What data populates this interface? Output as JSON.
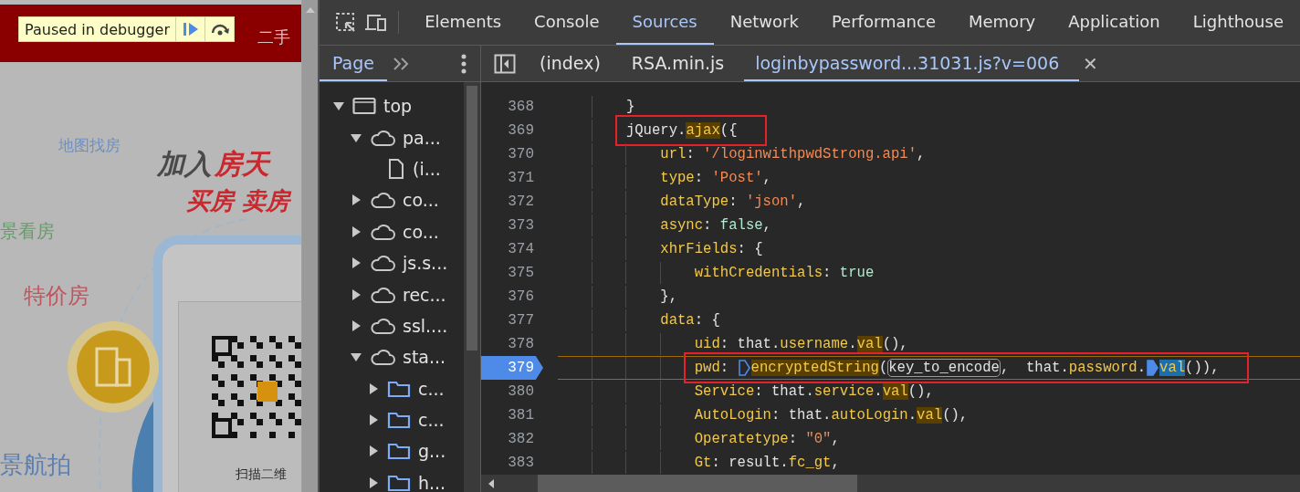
{
  "page": {
    "nav_item": "二手",
    "labels": [
      {
        "text": "地图找房",
        "color": "#6f8fc2"
      },
      {
        "text": "景看房",
        "color": "#6a9a6e"
      },
      {
        "text": "特价房",
        "color": "#c4545c"
      },
      {
        "text": "景航拍",
        "color": "#5b7fb4"
      }
    ],
    "heading": [
      {
        "text": "加入",
        "color": "#4a4a4a"
      },
      {
        "text": "房天",
        "color": "#c8282e"
      }
    ],
    "subheading": "买房 卖房",
    "qr_caption": "扫描二维"
  },
  "debugger_banner": {
    "text": "Paused in debugger"
  },
  "toolbar_tabs": [
    {
      "label": "Elements",
      "selected": false
    },
    {
      "label": "Console",
      "selected": false
    },
    {
      "label": "Sources",
      "selected": true
    },
    {
      "label": "Network",
      "selected": false
    },
    {
      "label": "Performance",
      "selected": false
    },
    {
      "label": "Memory",
      "selected": false
    },
    {
      "label": "Application",
      "selected": false
    },
    {
      "label": "Lighthouse",
      "selected": false
    }
  ],
  "navigator": {
    "tabs": [
      {
        "label": "Page",
        "selected": true
      }
    ],
    "tree": [
      {
        "label": "top",
        "kind": "frame",
        "expanded": true,
        "children": [
          {
            "label": "pa...",
            "kind": "cloud",
            "expanded": true,
            "children": [
              {
                "label": "(i...",
                "kind": "file"
              }
            ]
          },
          {
            "label": "co...",
            "kind": "cloud",
            "expanded": false
          },
          {
            "label": "co...",
            "kind": "cloud",
            "expanded": false
          },
          {
            "label": "js.s...",
            "kind": "cloud",
            "expanded": false
          },
          {
            "label": "rec...",
            "kind": "cloud",
            "expanded": false
          },
          {
            "label": "ssl....",
            "kind": "cloud",
            "expanded": false
          },
          {
            "label": "sta...",
            "kind": "cloud",
            "expanded": true,
            "children": [
              {
                "label": "c...",
                "kind": "folder",
                "expanded": false
              },
              {
                "label": "c...",
                "kind": "folder",
                "expanded": false
              },
              {
                "label": "g...",
                "kind": "folder",
                "expanded": false
              },
              {
                "label": "h...",
                "kind": "folder",
                "expanded": false
              }
            ]
          }
        ]
      }
    ]
  },
  "editor_tabs": [
    {
      "label": "(index)",
      "selected": false
    },
    {
      "label": "RSA.min.js",
      "selected": false
    },
    {
      "label": "loginbypassword...31031.js?v=006",
      "selected": true,
      "close_label": "✕"
    }
  ],
  "code_lines": [
    {
      "number": "368",
      "tokens": [
        {
          "text": "        }",
          "kind": "plain"
        }
      ]
    },
    {
      "number": "369",
      "annotated": true,
      "tokens": [
        {
          "text": "        jQuery.",
          "kind": "plain"
        },
        {
          "text": "ajax",
          "kind": "hl"
        },
        {
          "text": "({",
          "kind": "plain"
        }
      ]
    },
    {
      "number": "370",
      "tokens": [
        {
          "text": "            url",
          "kind": "prop"
        },
        {
          "text": ": ",
          "kind": "plain"
        },
        {
          "text": "'/loginwithpwdStrong.api'",
          "kind": "string"
        },
        {
          "text": ",",
          "kind": "plain"
        }
      ]
    },
    {
      "number": "371",
      "tokens": [
        {
          "text": "            type",
          "kind": "prop"
        },
        {
          "text": ": ",
          "kind": "plain"
        },
        {
          "text": "'Post'",
          "kind": "string"
        },
        {
          "text": ",",
          "kind": "plain"
        }
      ]
    },
    {
      "number": "372",
      "tokens": [
        {
          "text": "            dataType",
          "kind": "prop"
        },
        {
          "text": ": ",
          "kind": "plain"
        },
        {
          "text": "'json'",
          "kind": "string"
        },
        {
          "text": ",",
          "kind": "plain"
        }
      ]
    },
    {
      "number": "373",
      "tokens": [
        {
          "text": "            async",
          "kind": "prop"
        },
        {
          "text": ": ",
          "kind": "plain"
        },
        {
          "text": "false",
          "kind": "literal"
        },
        {
          "text": ",",
          "kind": "plain"
        }
      ]
    },
    {
      "number": "374",
      "tokens": [
        {
          "text": "            xhrFields",
          "kind": "prop"
        },
        {
          "text": ": {",
          "kind": "plain"
        }
      ]
    },
    {
      "number": "375",
      "tokens": [
        {
          "text": "                withCredentials",
          "kind": "prop"
        },
        {
          "text": ": ",
          "kind": "plain"
        },
        {
          "text": "true",
          "kind": "literal"
        }
      ]
    },
    {
      "number": "376",
      "tokens": [
        {
          "text": "            },",
          "kind": "plain"
        }
      ]
    },
    {
      "number": "377",
      "tokens": [
        {
          "text": "            data",
          "kind": "prop"
        },
        {
          "text": ": {",
          "kind": "plain"
        }
      ]
    },
    {
      "number": "378",
      "tokens": [
        {
          "text": "                uid",
          "kind": "prop"
        },
        {
          "text": ": that.",
          "kind": "plain"
        },
        {
          "text": "username",
          "kind": "prop"
        },
        {
          "text": ".",
          "kind": "plain"
        },
        {
          "text": "val",
          "kind": "hl"
        },
        {
          "text": "(),",
          "kind": "plain"
        }
      ]
    },
    {
      "number": "379",
      "current": true,
      "annotated": true,
      "tokens": [
        {
          "text": "                pwd",
          "kind": "prop"
        },
        {
          "text": ": ",
          "kind": "plain"
        },
        {
          "kind": "marker",
          "filled": false
        },
        {
          "text": "encryptedString",
          "kind": "hl"
        },
        {
          "text": "(",
          "kind": "plain"
        },
        {
          "text": "key_to_encode",
          "kind": "boxed"
        },
        {
          "text": ",  that.",
          "kind": "plain"
        },
        {
          "text": "password",
          "kind": "prop"
        },
        {
          "text": ".",
          "kind": "plain"
        },
        {
          "kind": "marker",
          "filled": true
        },
        {
          "text": "val",
          "kind": "selected"
        },
        {
          "text": "()),",
          "kind": "plain"
        }
      ]
    },
    {
      "number": "380",
      "tokens": [
        {
          "text": "                Service",
          "kind": "prop"
        },
        {
          "text": ": that.",
          "kind": "plain"
        },
        {
          "text": "service",
          "kind": "prop"
        },
        {
          "text": ".",
          "kind": "plain"
        },
        {
          "text": "val",
          "kind": "hl"
        },
        {
          "text": "(),",
          "kind": "plain"
        }
      ]
    },
    {
      "number": "381",
      "tokens": [
        {
          "text": "                AutoLogin",
          "kind": "prop"
        },
        {
          "text": ": that.",
          "kind": "plain"
        },
        {
          "text": "autoLogin",
          "kind": "prop"
        },
        {
          "text": ".",
          "kind": "plain"
        },
        {
          "text": "val",
          "kind": "hl"
        },
        {
          "text": "(),",
          "kind": "plain"
        }
      ]
    },
    {
      "number": "382",
      "tokens": [
        {
          "text": "                Operatetype",
          "kind": "prop"
        },
        {
          "text": ": ",
          "kind": "plain"
        },
        {
          "text": "\"0\"",
          "kind": "string"
        },
        {
          "text": ",",
          "kind": "plain"
        }
      ]
    },
    {
      "number": "383",
      "tokens": [
        {
          "text": "                Gt",
          "kind": "prop"
        },
        {
          "text": ": result.",
          "kind": "plain"
        },
        {
          "text": "fc_gt",
          "kind": "prop"
        },
        {
          "text": ",",
          "kind": "plain"
        }
      ]
    }
  ]
}
